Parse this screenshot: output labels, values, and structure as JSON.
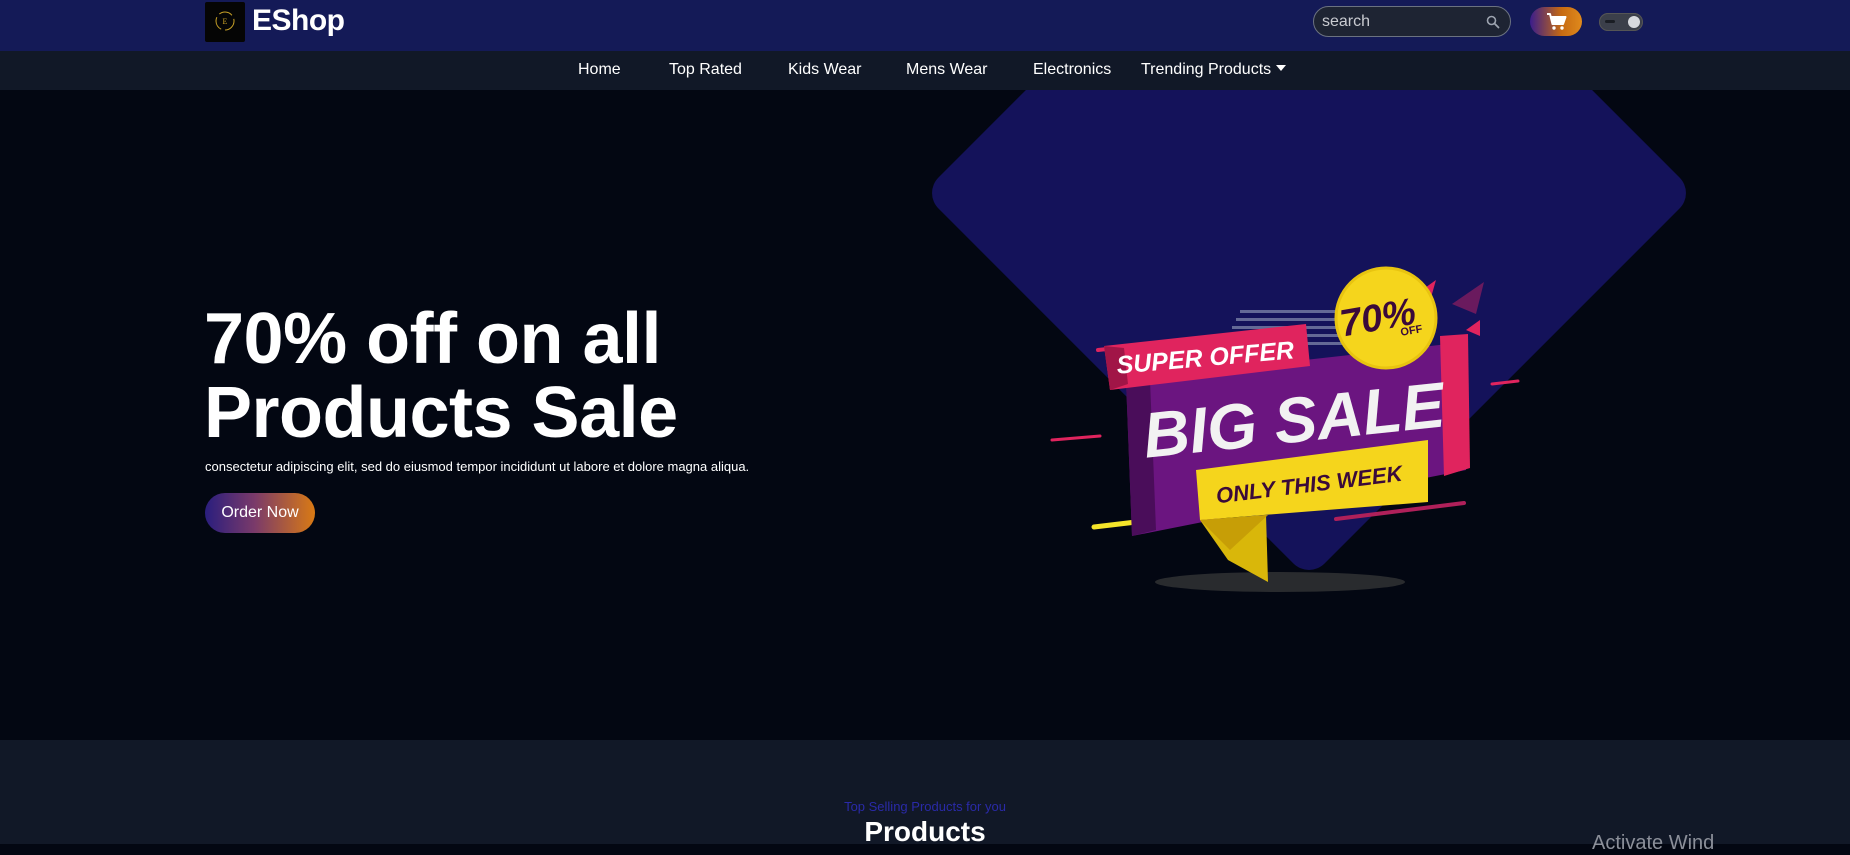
{
  "header": {
    "brand": "EShop",
    "logo_letter": "E",
    "search_placeholder": "search",
    "search_value": ""
  },
  "nav": {
    "items": [
      {
        "label": "Home"
      },
      {
        "label": "Top Rated"
      },
      {
        "label": "Kids Wear"
      },
      {
        "label": "Mens Wear"
      },
      {
        "label": "Electronics"
      },
      {
        "label": "Trending Products"
      }
    ]
  },
  "hero": {
    "headline_line1": "70% off on all",
    "headline_line2": "Products Sale",
    "subtext": "consectetur adipiscing elit, sed do eiusmod tempor incididunt ut labore et dolore magna aliqua.",
    "cta_label": "Order Now",
    "banner": {
      "super_offer": "SUPER OFFER",
      "big_sale": "BIG SALE",
      "only_this_week": "ONLY THIS WEEK",
      "badge_percent": "70%",
      "badge_off": "OFF"
    }
  },
  "products": {
    "tagline": "Top Selling Products for you",
    "title": "Products"
  },
  "watermark": "Activate Wind",
  "colors": {
    "topbar": "#141a57",
    "nav": "#111827",
    "hero_bg": "#030712",
    "diamond": "#14125a",
    "accent_orange": "#d97a14",
    "accent_indigo": "#2a1e7e"
  },
  "icons": {
    "search": "search-icon",
    "cart": "cart-icon",
    "toggle": "theme-toggle",
    "dropdown": "caret-down-icon"
  }
}
